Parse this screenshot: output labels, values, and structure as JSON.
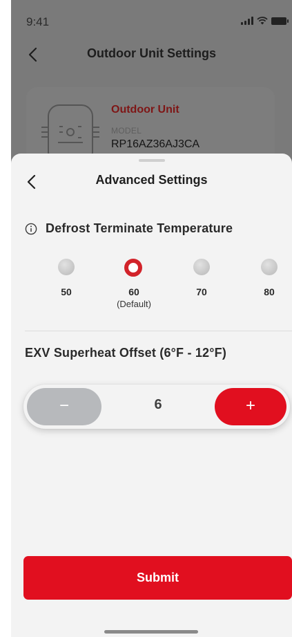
{
  "status_bar": {
    "time": "9:41"
  },
  "background_page": {
    "title": "Outdoor Unit Settings",
    "unit": {
      "name": "Outdoor Unit",
      "model_label": "MODEL",
      "model_value": "RP16AZ36AJ3CA"
    }
  },
  "sheet": {
    "title": "Advanced Settings",
    "defrost": {
      "title": "Defrost Terminate Temperature",
      "options": [
        {
          "value": "50",
          "note": ""
        },
        {
          "value": "60",
          "note": "(Default)"
        },
        {
          "value": "70",
          "note": ""
        },
        {
          "value": "80",
          "note": ""
        }
      ],
      "selected_index": 1
    },
    "exv": {
      "title": "EXV Superheat Offset (6°F - 12°F)",
      "minus_label": "−",
      "value": "6",
      "plus_label": "+"
    },
    "submit_label": "Submit"
  },
  "colors": {
    "accent_red": "#e10f1f",
    "selected_ring": "#d2232a",
    "minus_gray": "#b7b9bc",
    "overlay_dim": "#7a7a7a"
  }
}
